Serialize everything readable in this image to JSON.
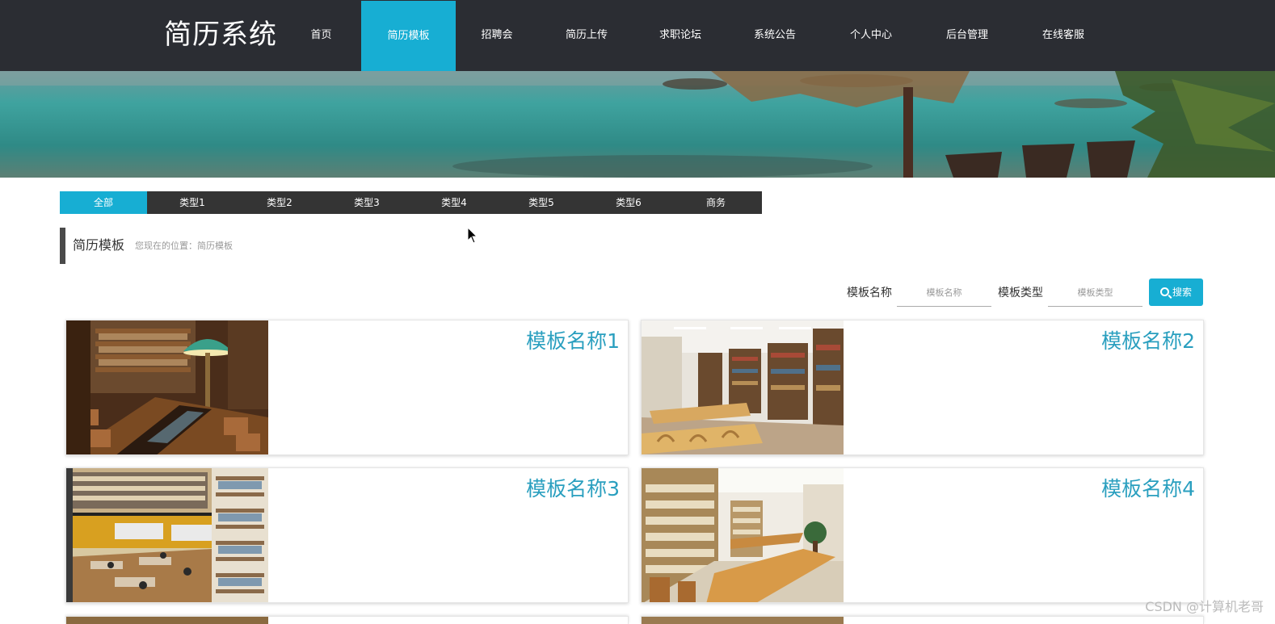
{
  "brand": "简历系统",
  "nav": [
    {
      "label": "首页",
      "active": false
    },
    {
      "label": "简历模板",
      "active": true
    },
    {
      "label": "招聘会",
      "active": false
    },
    {
      "label": "简历上传",
      "active": false
    },
    {
      "label": "求职论坛",
      "active": false
    },
    {
      "label": "系统公告",
      "active": false
    },
    {
      "label": "个人中心",
      "active": false
    },
    {
      "label": "后台管理",
      "active": false
    },
    {
      "label": "在线客服",
      "active": false
    }
  ],
  "categories": [
    {
      "label": "全部",
      "active": true
    },
    {
      "label": "类型1",
      "active": false
    },
    {
      "label": "类型2",
      "active": false
    },
    {
      "label": "类型3",
      "active": false
    },
    {
      "label": "类型4",
      "active": false
    },
    {
      "label": "类型5",
      "active": false
    },
    {
      "label": "类型6",
      "active": false
    },
    {
      "label": "商务",
      "active": false
    }
  ],
  "section": {
    "title": "简历模板",
    "location": "您现在的位置：简历模板"
  },
  "search": {
    "name_label": "模板名称",
    "name_placeholder": "模板名称",
    "type_label": "模板类型",
    "type_placeholder": "模板类型",
    "button_label": "搜索"
  },
  "cards": [
    {
      "title": "模板名称1",
      "image": "library-reading-room-lamp"
    },
    {
      "title": "模板名称2",
      "image": "library-stacks-tables"
    },
    {
      "title": "模板名称3",
      "image": "bookstore-multilevel-shelves"
    },
    {
      "title": "模板名称4",
      "image": "library-study-room"
    }
  ],
  "watermark": "CSDN @计算机老哥",
  "colors": {
    "nav_bg": "#2b2d33",
    "accent": "#17aed3",
    "card_title": "#2a9fbf",
    "category_bar": "#343434"
  }
}
